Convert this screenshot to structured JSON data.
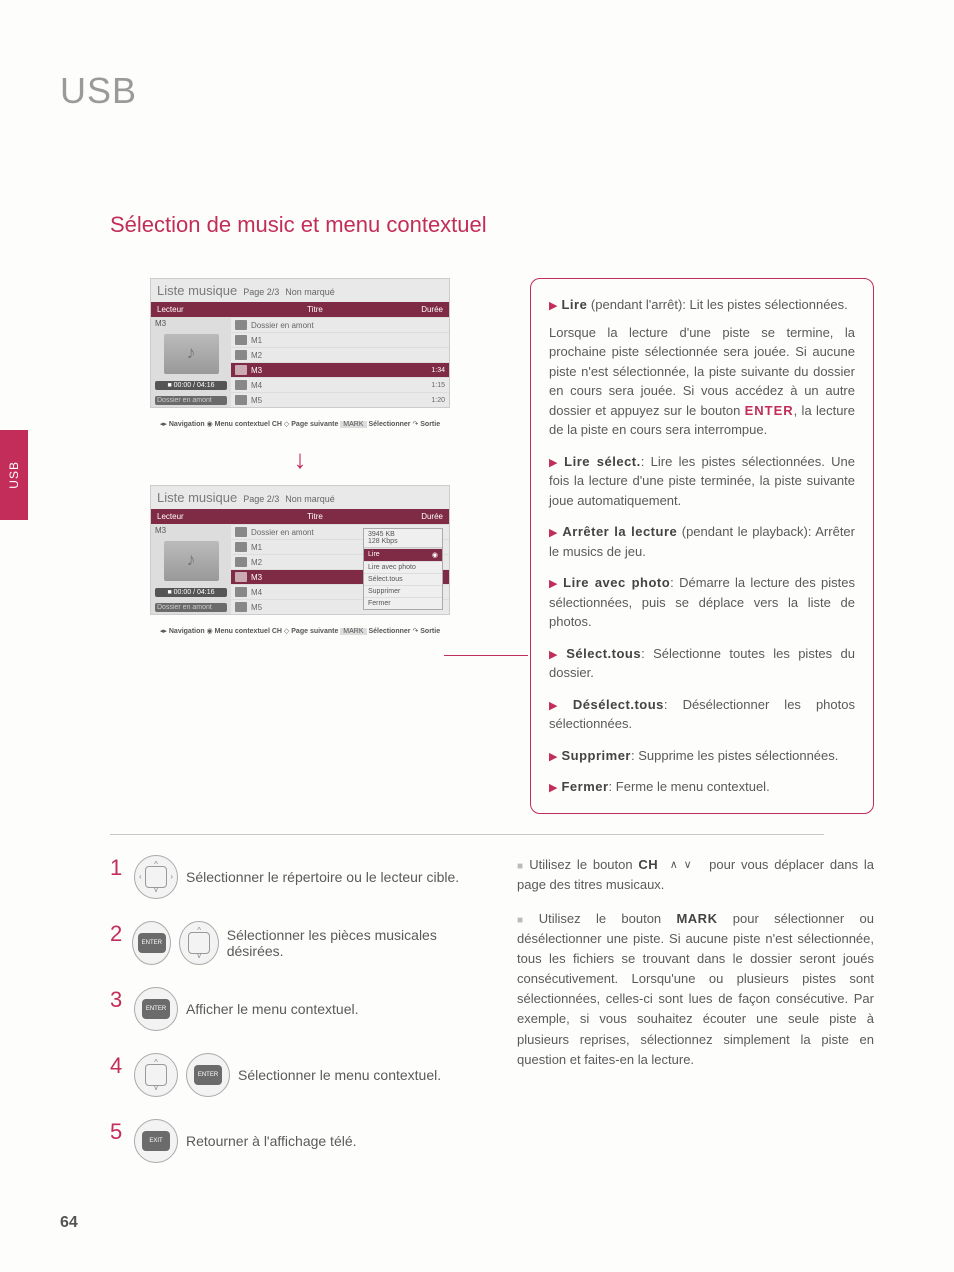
{
  "page": {
    "title": "USB",
    "section_title": "Sélection de music et menu contextuel",
    "side_tab": "USB",
    "page_number": "64"
  },
  "music_panel": {
    "title": "Liste musique",
    "page_info": "Page 2/3",
    "marked": "Non marqué",
    "col_player": "Lecteur",
    "col_title": "Titre",
    "col_duration": "Durée",
    "current": "M3",
    "time": "00:00 / 04:16",
    "upfolder": "Dossier en amont",
    "rows": [
      {
        "name": "Dossier en amont",
        "duration": ""
      },
      {
        "name": "M1",
        "duration": ""
      },
      {
        "name": "M2",
        "duration": ""
      },
      {
        "name": "M3",
        "duration": "1:34"
      },
      {
        "name": "M4",
        "duration": "1:15"
      },
      {
        "name": "M5",
        "duration": "1:20"
      }
    ],
    "nav_bar": {
      "navigation": "Navigation",
      "menu": "Menu contextuel",
      "ch": "CH",
      "page": "Page suivante",
      "mark": "MARK",
      "select": "Sélectionner",
      "exit": "Sortie"
    }
  },
  "context_popup": {
    "info_size": "3945 KB",
    "info_bitrate": "128 Kbps",
    "items": [
      "Lire",
      "Lire avec photo",
      "Sélect.tous",
      "Supprimer",
      "Fermer"
    ]
  },
  "descriptions": [
    {
      "term": "Lire",
      "paren": " (pendant l'arrêt): ",
      "text": "Lit les pistes sélectionnées.",
      "extra": "Lorsque la lecture d'une piste se termine, la prochaine piste sélectionnée sera jouée. Si aucune piste n'est sélectionnée, la piste suivante du dossier en cours sera jouée. Si vous accédez à un autre dossier et appuyez sur le bouton ",
      "enter": "ENTER",
      "extra2": ", la lecture de la piste en cours sera interrompue."
    },
    {
      "term": "Lire sélect.",
      "paren": ": ",
      "text": "Lire les pistes sélectionnées. Une fois la lecture d'une piste terminée, la piste suivante joue automatiquement."
    },
    {
      "term": "Arrêter la lecture",
      "paren": " (pendant le playback): ",
      "text": "Arrêter le musics de jeu."
    },
    {
      "term": "Lire avec photo",
      "paren": ": ",
      "text": "Démarre la lecture des pistes sélectionnées, puis se déplace vers la liste de photos."
    },
    {
      "term": "Sélect.tous",
      "paren": ": ",
      "text": "Sélectionne toutes les pistes du dossier."
    },
    {
      "term": "Désélect.tous",
      "paren": ": ",
      "text": "Désélectionner les photos sélectionnées."
    },
    {
      "term": "Supprimer",
      "paren": ": ",
      "text": "Supprime les pistes sélectionnées."
    },
    {
      "term": "Fermer",
      "paren": ": ",
      "text": "Ferme le menu contextuel."
    }
  ],
  "steps": [
    {
      "num": "1",
      "text": "Sélectionner le répertoire ou le lecteur cible."
    },
    {
      "num": "2",
      "text": "Sélectionner les pièces musicales désirées."
    },
    {
      "num": "3",
      "text": "Afficher le menu contextuel."
    },
    {
      "num": "4",
      "text": "Sélectionner le menu contextuel."
    },
    {
      "num": "5",
      "text": "Retourner à l'affichage télé."
    }
  ],
  "buttons": {
    "enter": "ENTER",
    "exit": "EXIT"
  },
  "notes": {
    "n1a": "Utilisez le bouton ",
    "n1_kw": "CH",
    "n1b": " pour vous déplacer dans la page des titres musicaux.",
    "n2a": "Utilisez le bouton ",
    "n2_kw": "MARK",
    "n2b": " pour sélectionner ou désélectionner une piste. Si aucune piste n'est sélectionnée, tous les fichiers se trouvant dans le dossier seront joués consécutivement. Lorsqu'une ou plusieurs pistes sont sélectionnées, celles-ci sont lues de façon consécutive. Par exemple, si vous souhaitez écouter une seule piste à plusieurs reprises, sélectionnez simplement la piste en question et faites-en la lecture."
  }
}
